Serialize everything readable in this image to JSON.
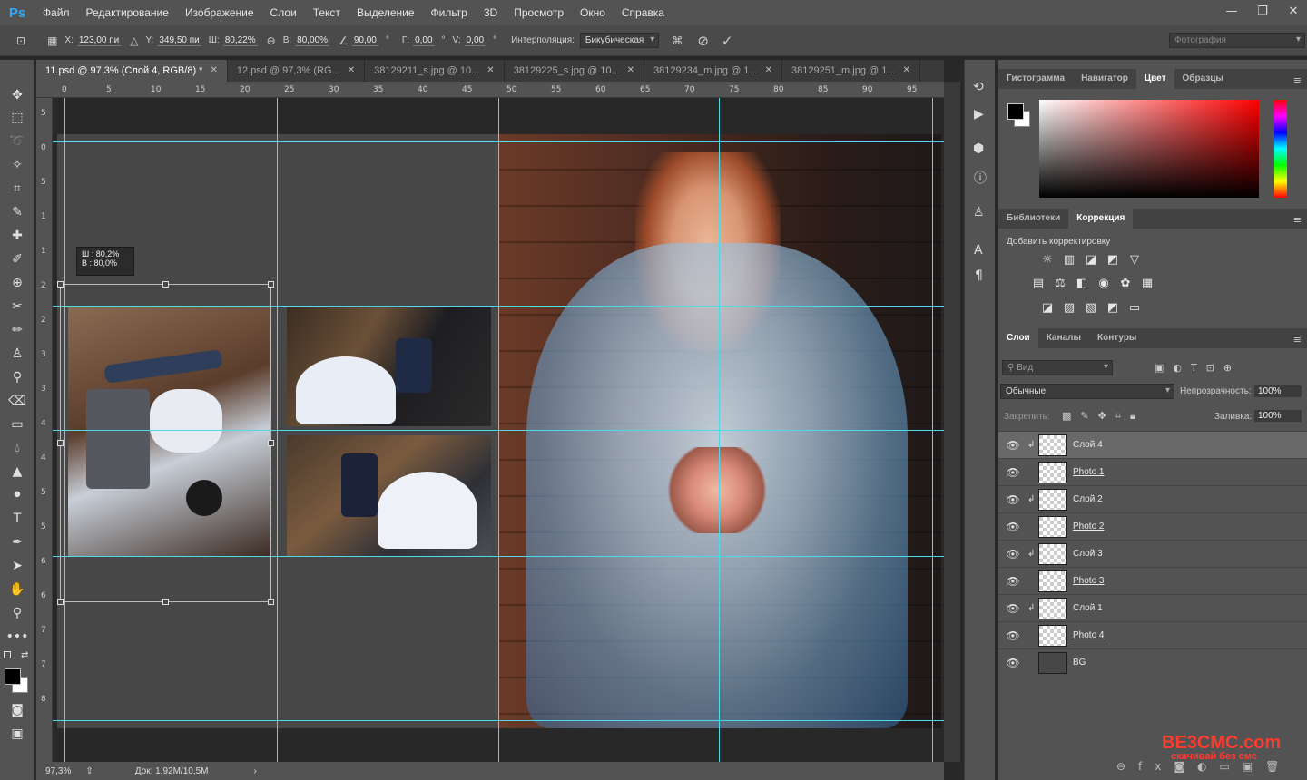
{
  "app": {
    "logo": "Ps"
  },
  "menu": [
    "Файл",
    "Редактирование",
    "Изображение",
    "Слои",
    "Текст",
    "Выделение",
    "Фильтр",
    "3D",
    "Просмотр",
    "Окно",
    "Справка"
  ],
  "window_controls": {
    "min": "—",
    "restore": "❐",
    "close": "✕"
  },
  "options": {
    "x_label": "X:",
    "x_value": "123,00 пи",
    "y_label": "Y:",
    "y_value": "349,50 пи",
    "w_label": "Ш:",
    "w_value": "80,22%",
    "h_label": "В:",
    "h_value": "80,00%",
    "angle_value": "90,00",
    "angle_unit": "°",
    "hskew_label": "Г:",
    "hskew_value": "0,00",
    "vskew_label": "V:",
    "vskew_value": "0,00",
    "skew_unit": "°",
    "interp_label": "Интерполяция:",
    "interp_value": "Бикубическая",
    "workspace": "Фотография"
  },
  "tabs": [
    {
      "label": "11.psd @ 97,3% (Слой 4, RGB/8) *",
      "active": true
    },
    {
      "label": "12.psd @ 97,3% (RG...",
      "active": false
    },
    {
      "label": "38129211_s.jpg @ 10...",
      "active": false
    },
    {
      "label": "38129225_s.jpg @ 10...",
      "active": false
    },
    {
      "label": "38129234_m.jpg @ 1...",
      "active": false
    },
    {
      "label": "38129251_m.jpg @ 1...",
      "active": false
    }
  ],
  "ruler_h": [
    "0",
    "5",
    "10",
    "15",
    "20",
    "25",
    "30",
    "35",
    "40",
    "45",
    "50",
    "55",
    "60",
    "65",
    "70",
    "75",
    "80",
    "85",
    "90",
    "95"
  ],
  "ruler_v": [
    "5",
    "0",
    "5",
    "1",
    "1",
    "2",
    "2",
    "3",
    "3",
    "4",
    "4",
    "5",
    "5",
    "6",
    "6",
    "7",
    "7",
    "8"
  ],
  "transform_tooltip": {
    "w": "Ш :  80,2%",
    "h": "В :  80,0%"
  },
  "status": {
    "zoom": "97,3%",
    "doc": "Док: 1,92M/10,5M"
  },
  "panels": {
    "top_tabs": [
      "Гистограмма",
      "Навигатор",
      "Цвет",
      "Образцы"
    ],
    "mid_tabs": [
      "Библиотеки",
      "Коррекция"
    ],
    "adjust_title": "Добавить корректировку",
    "layer_tabs": [
      "Слои",
      "Каналы",
      "Контуры"
    ],
    "layer_kind": "Вид",
    "blend_mode": "Обычные",
    "opacity_label": "Непрозрачность:",
    "opacity_value": "100%",
    "lock_label": "Закрепить:",
    "fill_label": "Заливка:",
    "fill_value": "100%"
  },
  "layers": [
    {
      "name": "Слой 4",
      "clip": true,
      "underline": false,
      "selected": true
    },
    {
      "name": "Photo 1",
      "clip": false,
      "underline": true,
      "selected": false
    },
    {
      "name": "Слой 2",
      "clip": true,
      "underline": false,
      "selected": false
    },
    {
      "name": "Photo 2",
      "clip": false,
      "underline": true,
      "selected": false
    },
    {
      "name": "Слой 3",
      "clip": true,
      "underline": false,
      "selected": false
    },
    {
      "name": "Photo 3",
      "clip": false,
      "underline": true,
      "selected": false
    },
    {
      "name": "Слой 1",
      "clip": true,
      "underline": false,
      "selected": false
    },
    {
      "name": "Photo 4",
      "clip": false,
      "underline": true,
      "selected": false
    },
    {
      "name": "BG",
      "clip": false,
      "underline": false,
      "selected": false
    }
  ],
  "watermark": {
    "brand": "BE3CMC.com",
    "tagline": "скачивай без смс"
  },
  "colors": {
    "guide": "#4fd9e8",
    "accent": "#31a8ff"
  }
}
